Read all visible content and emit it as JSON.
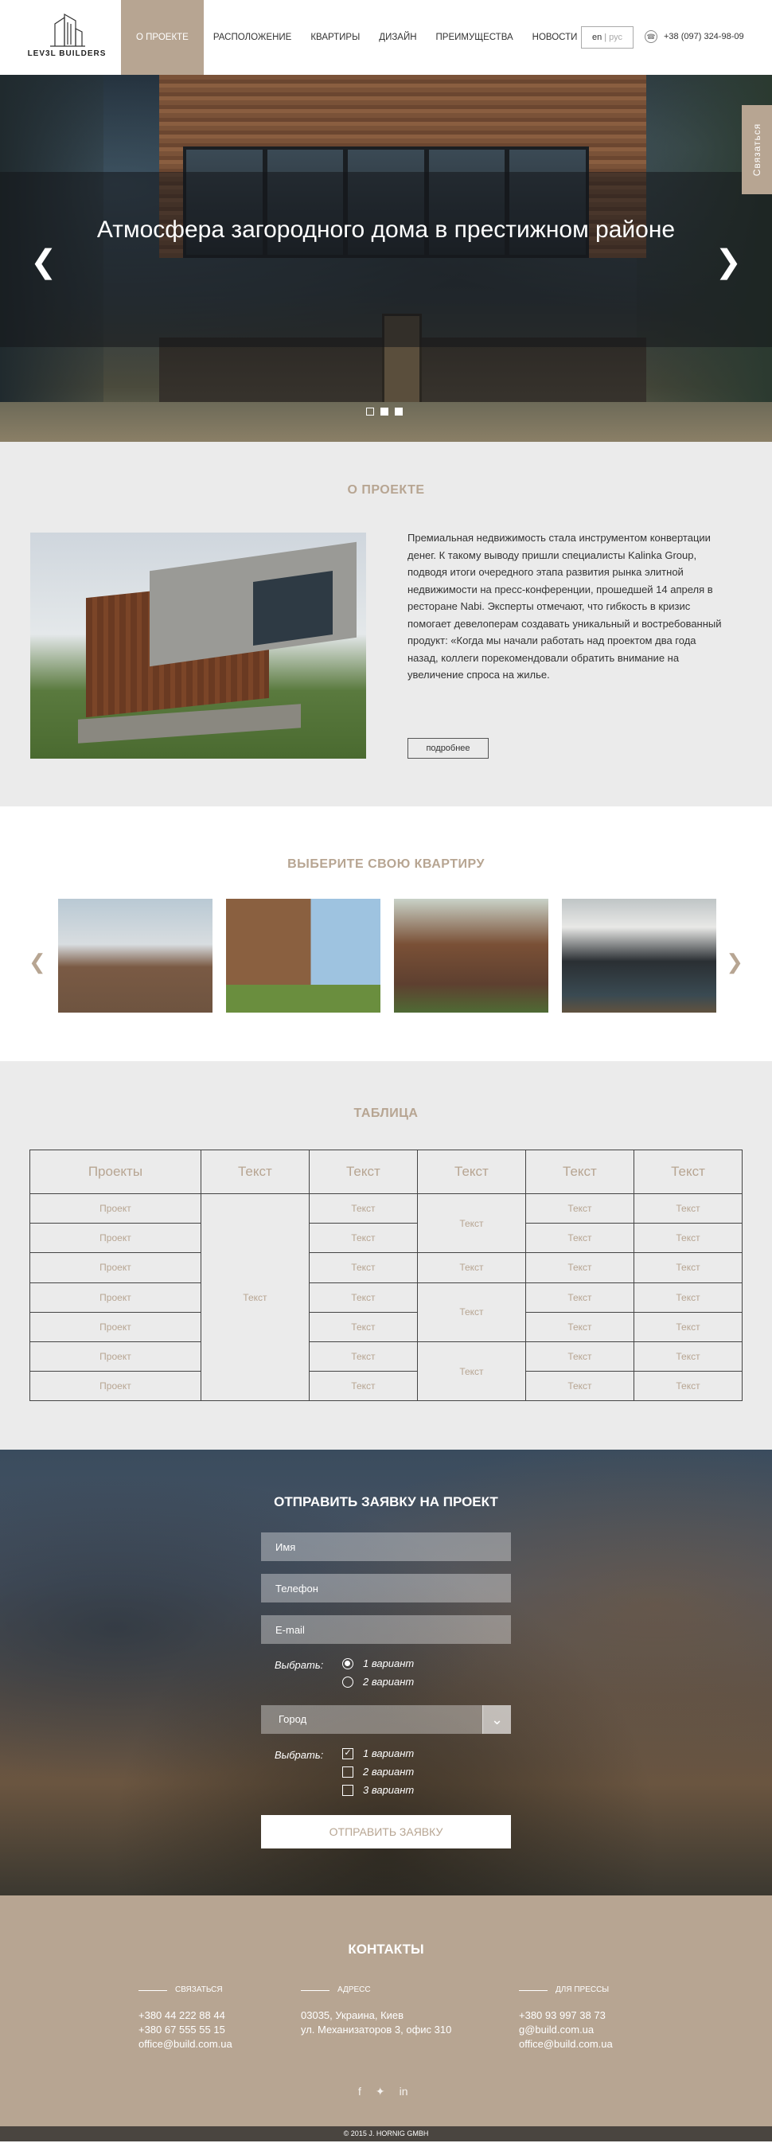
{
  "brand": {
    "logo_text": "LEV3L BUILDERS"
  },
  "nav": {
    "items": [
      {
        "label": "О ПРОЕКТЕ"
      },
      {
        "label": "РАСПОЛОЖЕНИЕ"
      },
      {
        "label": "КВАРТИРЫ"
      },
      {
        "label": "ДИЗАЙН"
      },
      {
        "label": "ПРЕИМУЩЕСТВА"
      },
      {
        "label": "НОВОСТИ"
      }
    ],
    "active_index": 0
  },
  "lang": {
    "current": "en",
    "other": "рус"
  },
  "phone": "+38 (097) 324-98-09",
  "contact_tab": "Связаться",
  "hero": {
    "title": "Атмосфера загородного дома в престижном районе",
    "dots": 3,
    "active_dot": 1
  },
  "about": {
    "title": "О ПРОЕКТЕ",
    "text": "Премиальная недвижимость стала инструментом конвертации денег. К такому выводу пришли специалисты Kalinka Group, подводя итоги очередного этапа развития рынка элитной недвижимости на пресс-конференции, прошедшей 14 апреля в ресторане Nabi. Эксперты отмечают, что гибкость в кризис помогает девелоперам создавать уникальный и востребованный продукт: «Когда мы начали работать над проектом два года назад, коллеги порекомендовали обратить внимание на увеличение спроса на жилье.",
    "button": "подробнее"
  },
  "choose": {
    "title": "ВЫБЕРИТЕ СВОЮ КВАРТИРУ"
  },
  "table": {
    "title": "ТАБЛИЦА",
    "headers": [
      "Проекты",
      "Текст",
      "Текст",
      "Текст",
      "Текст",
      "Текст"
    ],
    "cell_project": "Проект",
    "cell_text": "Текст"
  },
  "form": {
    "title": "ОТПРАВИТЬ ЗАЯВКУ НА ПРОЕКТ",
    "name_placeholder": "Имя",
    "phone_placeholder": "Телефон",
    "email_placeholder": "E-mail",
    "choose_label": "Выбрать:",
    "radio_options": [
      "1 вариант",
      "2 вариант"
    ],
    "radio_selected": 0,
    "city_select": "Город",
    "checkbox_options": [
      "1 вариант",
      "2 вариант",
      "3 вариант"
    ],
    "checkbox_checked": [
      0
    ],
    "submit": "ОТПРАВИТЬ ЗАЯВКУ"
  },
  "footer": {
    "title": "КОНТАКТЫ",
    "col1": {
      "tag": "СВЯЗАТЬСЯ",
      "lines": [
        "+380 44 222 88 44",
        "+380 67 555 55 15",
        "office@build.com.ua"
      ]
    },
    "col2": {
      "tag": "АДРЕСС",
      "lines": [
        "03035, Украина, Киев",
        "ул. Механизаторов 3, офис 310"
      ]
    },
    "col3": {
      "tag": "ДЛЯ ПРЕССЫ",
      "lines": [
        "+380 93 997 38 73",
        "g@build.com.ua",
        "office@build.com.ua"
      ]
    },
    "social": [
      "facebook-icon",
      "twitter-icon",
      "linkedin-icon"
    ],
    "copyright": "© 2015 J. HORNIG GMBH"
  },
  "colors": {
    "accent": "#b7a592",
    "bg_light": "#ebebeb"
  }
}
